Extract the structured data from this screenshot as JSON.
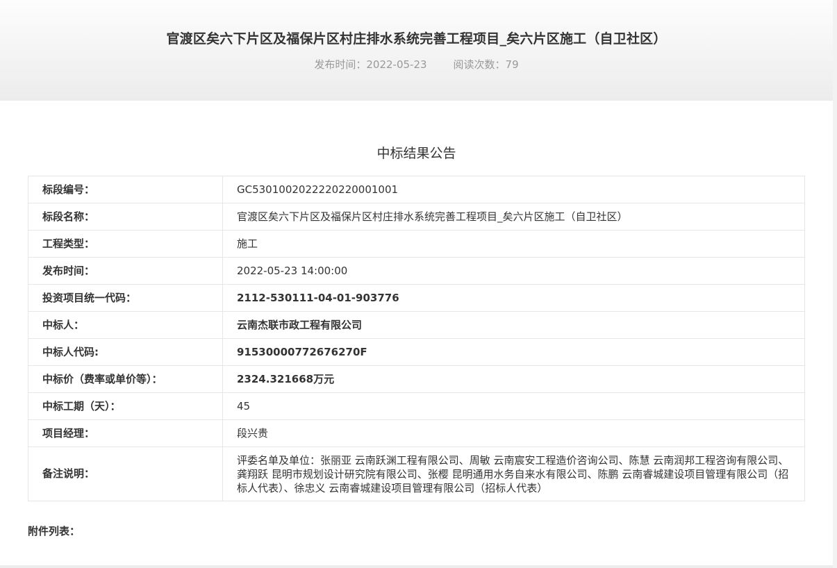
{
  "article": {
    "title": "官渡区矣六下片区及福保片区村庄排水系统完善工程项目_矣六片区施工（自卫社区）",
    "publish_time": "发布时间：2022-05-23",
    "read_count": "阅读次数：79"
  },
  "notice": {
    "heading": "中标结果公告",
    "rows": [
      {
        "label": "标段编号：",
        "value": "GC5301002022220220001001"
      },
      {
        "label": "标段名称：",
        "value": "官渡区矣六下片区及福保片区村庄排水系统完善工程项目_矣六片区施工（自卫社区）"
      },
      {
        "label": "工程类型：",
        "value": "施工"
      },
      {
        "label": "发布时间：",
        "value": "2022-05-23 14:00:00"
      },
      {
        "label": "投资项目统一代码：",
        "value": "2112-530111-04-01-903776"
      },
      {
        "label": "中标人：",
        "value": "云南杰联市政工程有限公司"
      },
      {
        "label": "中标人代码:",
        "value": "91530000772676270F"
      },
      {
        "label": "中标价（费率或单价等）：",
        "value": "2324.321668万元"
      },
      {
        "label": "中标工期（天）：",
        "value": "45"
      },
      {
        "label": "项目经理：",
        "value": "段兴贵"
      },
      {
        "label": "备注说明：",
        "value": "评委名单及单位：张丽亚 云南跃渊工程有限公司、周敏 云南宸安工程造价咨询公司、陈慧 云南润邦工程咨询有限公司、龚翔跃 昆明市规划设计研究院有限公司、张樱 昆明通用水务自来水有限公司、陈鹏 云南睿城建设项目管理有限公司（招标人代表）、徐忠义 云南睿城建设项目管理有限公司（招标人代表）"
      }
    ],
    "attachments_label": "附件列表："
  }
}
